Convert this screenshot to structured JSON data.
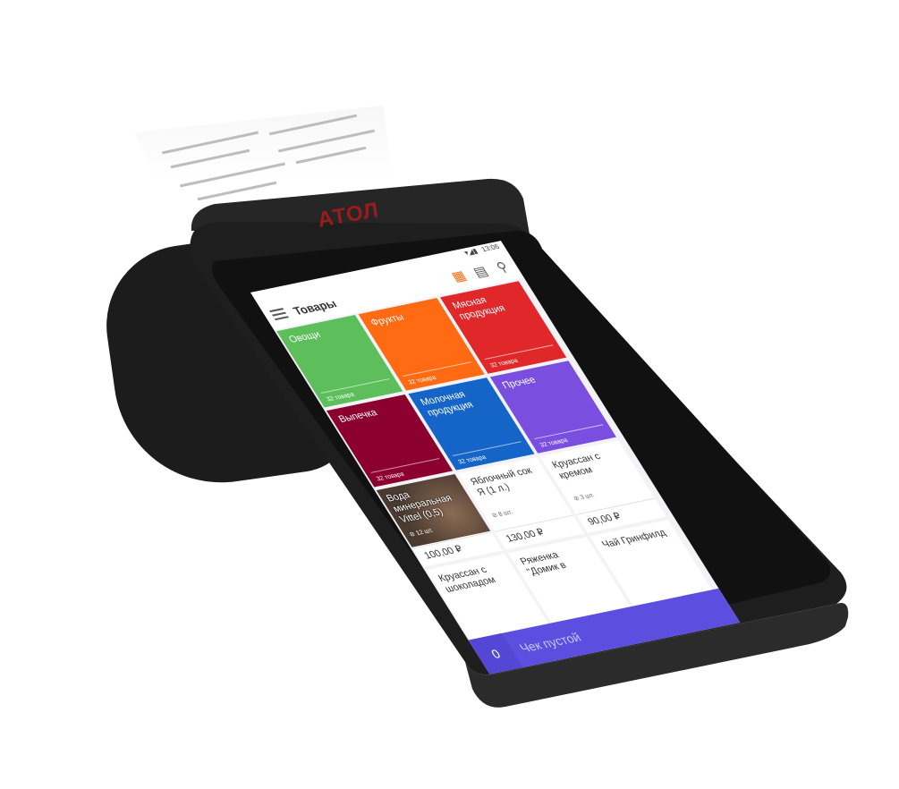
{
  "device": {
    "brand": "АТОЛ"
  },
  "status_bar": {
    "time": "13:06",
    "icons": "▾◢▮"
  },
  "app_bar": {
    "title": "Товары",
    "menu_icon": "menu-icon",
    "actions": [
      "grid-view-icon",
      "calculator-icon",
      "search-icon"
    ]
  },
  "categories": [
    {
      "name": "Овощи",
      "count": "32 товара",
      "color": "#5cbf5c"
    },
    {
      "name": "Фрукты",
      "count": "32 товара",
      "color": "#ff6a13"
    },
    {
      "name": "Мясная продукция",
      "count": "32 товара",
      "color": "#e0282a"
    },
    {
      "name": "Выпечка",
      "count": "32 товара",
      "color": "#8c0030"
    },
    {
      "name": "Молочная продукция",
      "count": "32 товара",
      "color": "#1565c8"
    },
    {
      "name": "Прочее",
      "count": "32 товара",
      "color": "#7a4fe0"
    }
  ],
  "products": [
    {
      "name": "Вода минеральная Vittel (0,5)",
      "qty": "12 шт.",
      "price": "100,00 ₽"
    },
    {
      "name": "Яблочный сок Я (1 л.)",
      "qty": "8 шт.",
      "price": "130,00 ₽"
    },
    {
      "name": "Круассан с кремом",
      "qty": "3 шт.",
      "price": "90,00 ₽"
    },
    {
      "name": "Круассан с шоколадом",
      "qty": "",
      "price": ""
    },
    {
      "name": "Ряженка \"Домик в",
      "qty": "",
      "price": ""
    },
    {
      "name": "Чай Гринфилд",
      "qty": "",
      "price": ""
    }
  ],
  "bottom_bar": {
    "count": "0",
    "status": "Чек пустой"
  },
  "colors": {
    "accent": "#5c4fe0",
    "bezel": "#1e1e1e"
  }
}
